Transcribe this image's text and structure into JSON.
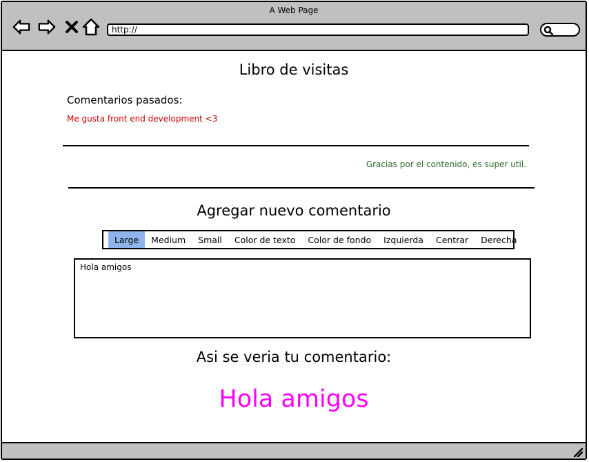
{
  "window": {
    "title": "A Web Page"
  },
  "browser": {
    "url": "http://",
    "nav_icons": [
      "back-arrow-icon",
      "forward-arrow-icon",
      "close-x-icon",
      "home-icon"
    ],
    "search_icon": "search-icon"
  },
  "page": {
    "title": "Libro de visitas",
    "past_comments_label": "Comentarios pasados:",
    "comments": [
      {
        "text": "Me gusta front end development <3",
        "color": "#cc0000"
      },
      {
        "text": "Gracias por el contenido, es super util.",
        "color": "#2a6a2a"
      }
    ],
    "add_heading": "Agregar nuevo comentario",
    "toolbar": {
      "items": [
        "Large",
        "Medium",
        "Small",
        "Color de texto",
        "Color de fondo",
        "Izquierda",
        "Centrar",
        "Derecha"
      ],
      "selected": "Large",
      "selected_color": "#8fb3eb"
    },
    "input_text": "Hola amigos",
    "preview_heading": "Asi se veria tu comentario:",
    "preview_text": "Hola amigos",
    "preview_color": "#ff00ff"
  }
}
